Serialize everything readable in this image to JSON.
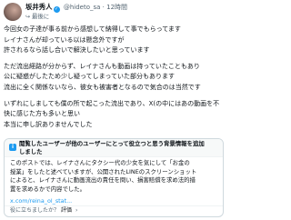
{
  "post": {
    "author": {
      "display_name": "坂井秀人",
      "handle": "@hideto_sa",
      "separator": "·",
      "time": "12時間"
    },
    "reply_prefix": "に返信",
    "reply_to": "最後に",
    "body_lines": [
      "今回女の子達が事る前から感想して納得して事でもらってます",
      "レイナさんが却っている以は懸念外ですが",
      "許されるなら話し合いで解決したいと思っています",
      "",
      "ただ流出経路が分からず、レイナさんも動画は持っていたこともあり",
      "公に疑惑がしたため少し疑ってしまっていた部分もあります",
      "流出に全く関係ないなら、彼女も被害者となるので気合のは当然です",
      "",
      "いずれにしましても僕の所で起こった流出であり、X(の中にはあの動画を不",
      "快に感じた方も多いと思い",
      "本当に申し訳ありませんでした"
    ]
  },
  "note": {
    "title_line1": "閲覧したユーザーが他のユーザーにとって役立つと思う背景情報を追加",
    "title_line2": "しました",
    "body_lines": [
      "このポストでは、レイナさんにタクシー代の少女を気にして「お金の",
      "授業」をしたと述べていますが、公開されたLINEのスクリーンショット",
      "によると、レイナさんに動画流出の責任を問い、損害賠償を求め法的措",
      "置を求めるかで内容でした。"
    ],
    "link": "x.com/reina_ol_stat...",
    "footer_prompt": "役に立ちましたか？",
    "footer_action": "評価"
  }
}
